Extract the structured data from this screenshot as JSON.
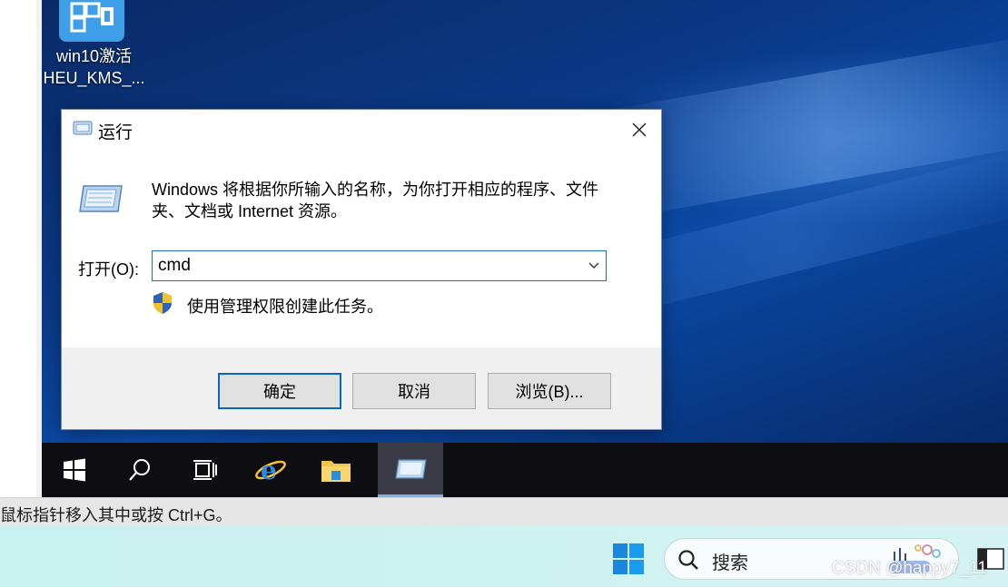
{
  "desktop": {
    "icon_label_line1": "win10激活",
    "icon_label_line2": "HEU_KMS_..."
  },
  "dialog": {
    "title": "运行",
    "description": "Windows 将根据你所输入的名称，为你打开相应的程序、文件夹、文档或 Internet 资源。",
    "open_label": "打开(O):",
    "input_value": "cmd",
    "admin_note": "使用管理权限创建此任务。",
    "buttons": {
      "ok": "确定",
      "cancel": "取消",
      "browse": "浏览(B)..."
    }
  },
  "vm_taskbar": {
    "items": [
      "start-icon",
      "search-icon",
      "task-view-icon",
      "internet-explorer-icon",
      "file-explorer-icon",
      "run-icon"
    ],
    "active_item": "run-icon"
  },
  "statusbar": {
    "text": "鼠标指针移入其中或按 Ctrl+G。"
  },
  "host_taskbar": {
    "search_placeholder": "搜索"
  },
  "watermark": "CSDN @happy7_11",
  "colors": {
    "accent": "#0a64c8",
    "desktop_bg": "#0a3a8a",
    "taskbar_bg": "#0e0e12",
    "host_taskbar_bg": "#c8f1ef"
  }
}
